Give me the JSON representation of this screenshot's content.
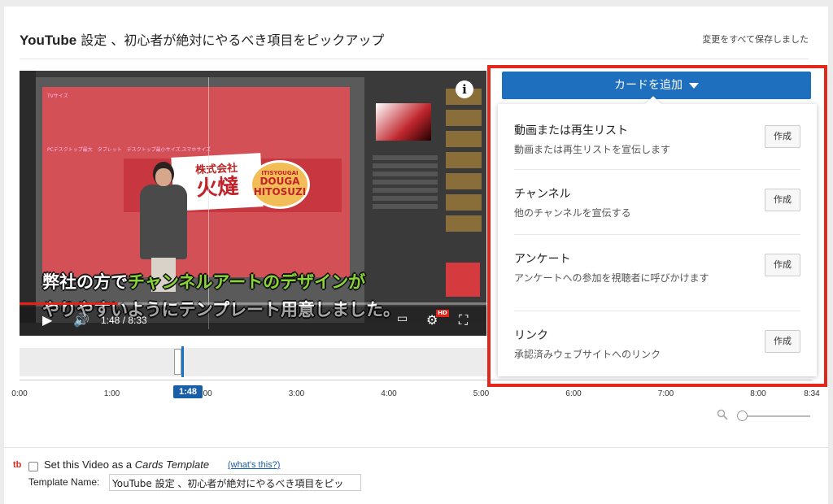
{
  "header": {
    "title_prefix": "YouTube",
    "title_rest": " 設定 、初心者が絶対にやるべき項目をピックアップ",
    "saved_status": "変更をすべて保存しました"
  },
  "video": {
    "art_label_tv": "TVサイズ",
    "art_label_sizes": "PCデスクトップ最大　タブレット　デスクトップ最小サイズ,スマホサイズ",
    "company_small": "株式会社",
    "company_big": "火燵",
    "oval_top": "ITISYOUGAI",
    "oval_mid": "DOUGA",
    "oval_bottom": "HITOSUZI",
    "subtitle_line1_white": "弊社の方で",
    "subtitle_line1_green": "チャンネルアートのデザインが",
    "subtitle_line2_white": "やりやすいようにテンプレート用意しました。",
    "time_display": "1:48 / 8:33",
    "hd_badge": "HD",
    "info_icon_text": "i",
    "progress_fraction": 0.21
  },
  "timeline": {
    "ticks": [
      "0:00",
      "1:00",
      "2:00",
      "3:00",
      "4:00",
      "5:00",
      "6:00",
      "7:00",
      "8:00",
      "8:34"
    ],
    "current_marker": "1:48"
  },
  "cards": {
    "add_button_label": "カードを追加",
    "options": [
      {
        "name": "動画または再生リスト",
        "desc": "動画または再生リストを宣伝します",
        "button": "作成"
      },
      {
        "name": "チャンネル",
        "desc": "他のチャンネルを宣伝する",
        "button": "作成"
      },
      {
        "name": "アンケート",
        "desc": "アンケートへの参加を視聴者に呼びかけます",
        "button": "作成"
      },
      {
        "name": "リンク",
        "desc": "承認済みウェブサイトへのリンク",
        "button": "作成"
      }
    ]
  },
  "template": {
    "logo": "tb",
    "checkbox_label_pre": "Set this Video as a ",
    "checkbox_label_em": "Cards Template",
    "whats_this": "(what's this?)",
    "name_label": "Template Name:",
    "name_value": "YouTube 設定 、初心者が絶対にやるべき項目をピッ"
  },
  "colors": {
    "accent_blue": "#1f6fbf",
    "highlight_red": "#e2281b",
    "subtitle_green": "#8ad43a"
  }
}
